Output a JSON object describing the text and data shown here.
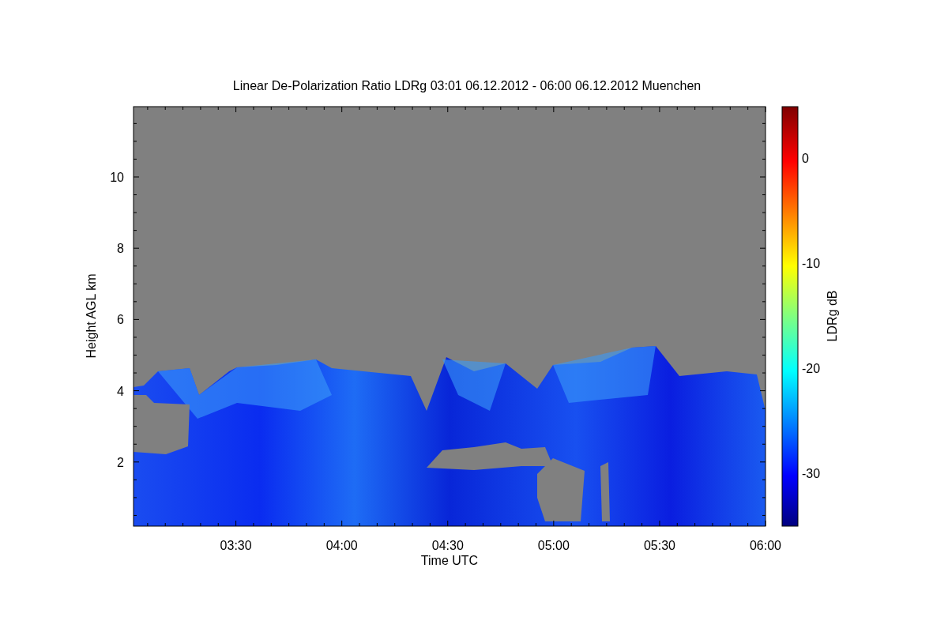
{
  "title": "Linear De-Polarization Ratio LDRg   03:01 06.12.2012 - 06:00 06.12.2012 Muenchen",
  "plot": {
    "xlabel": "Time UTC",
    "ylabel": "Height AGL km",
    "xticks": [
      "03:30",
      "04:00",
      "04:30",
      "05:00",
      "05:30",
      "06:00"
    ],
    "yticks": [
      "10",
      "8",
      "6",
      "4",
      "2"
    ]
  },
  "colorbar": {
    "label": "LDRg dB",
    "ticks": [
      "0",
      "-10",
      "-20",
      "-30"
    ]
  }
}
